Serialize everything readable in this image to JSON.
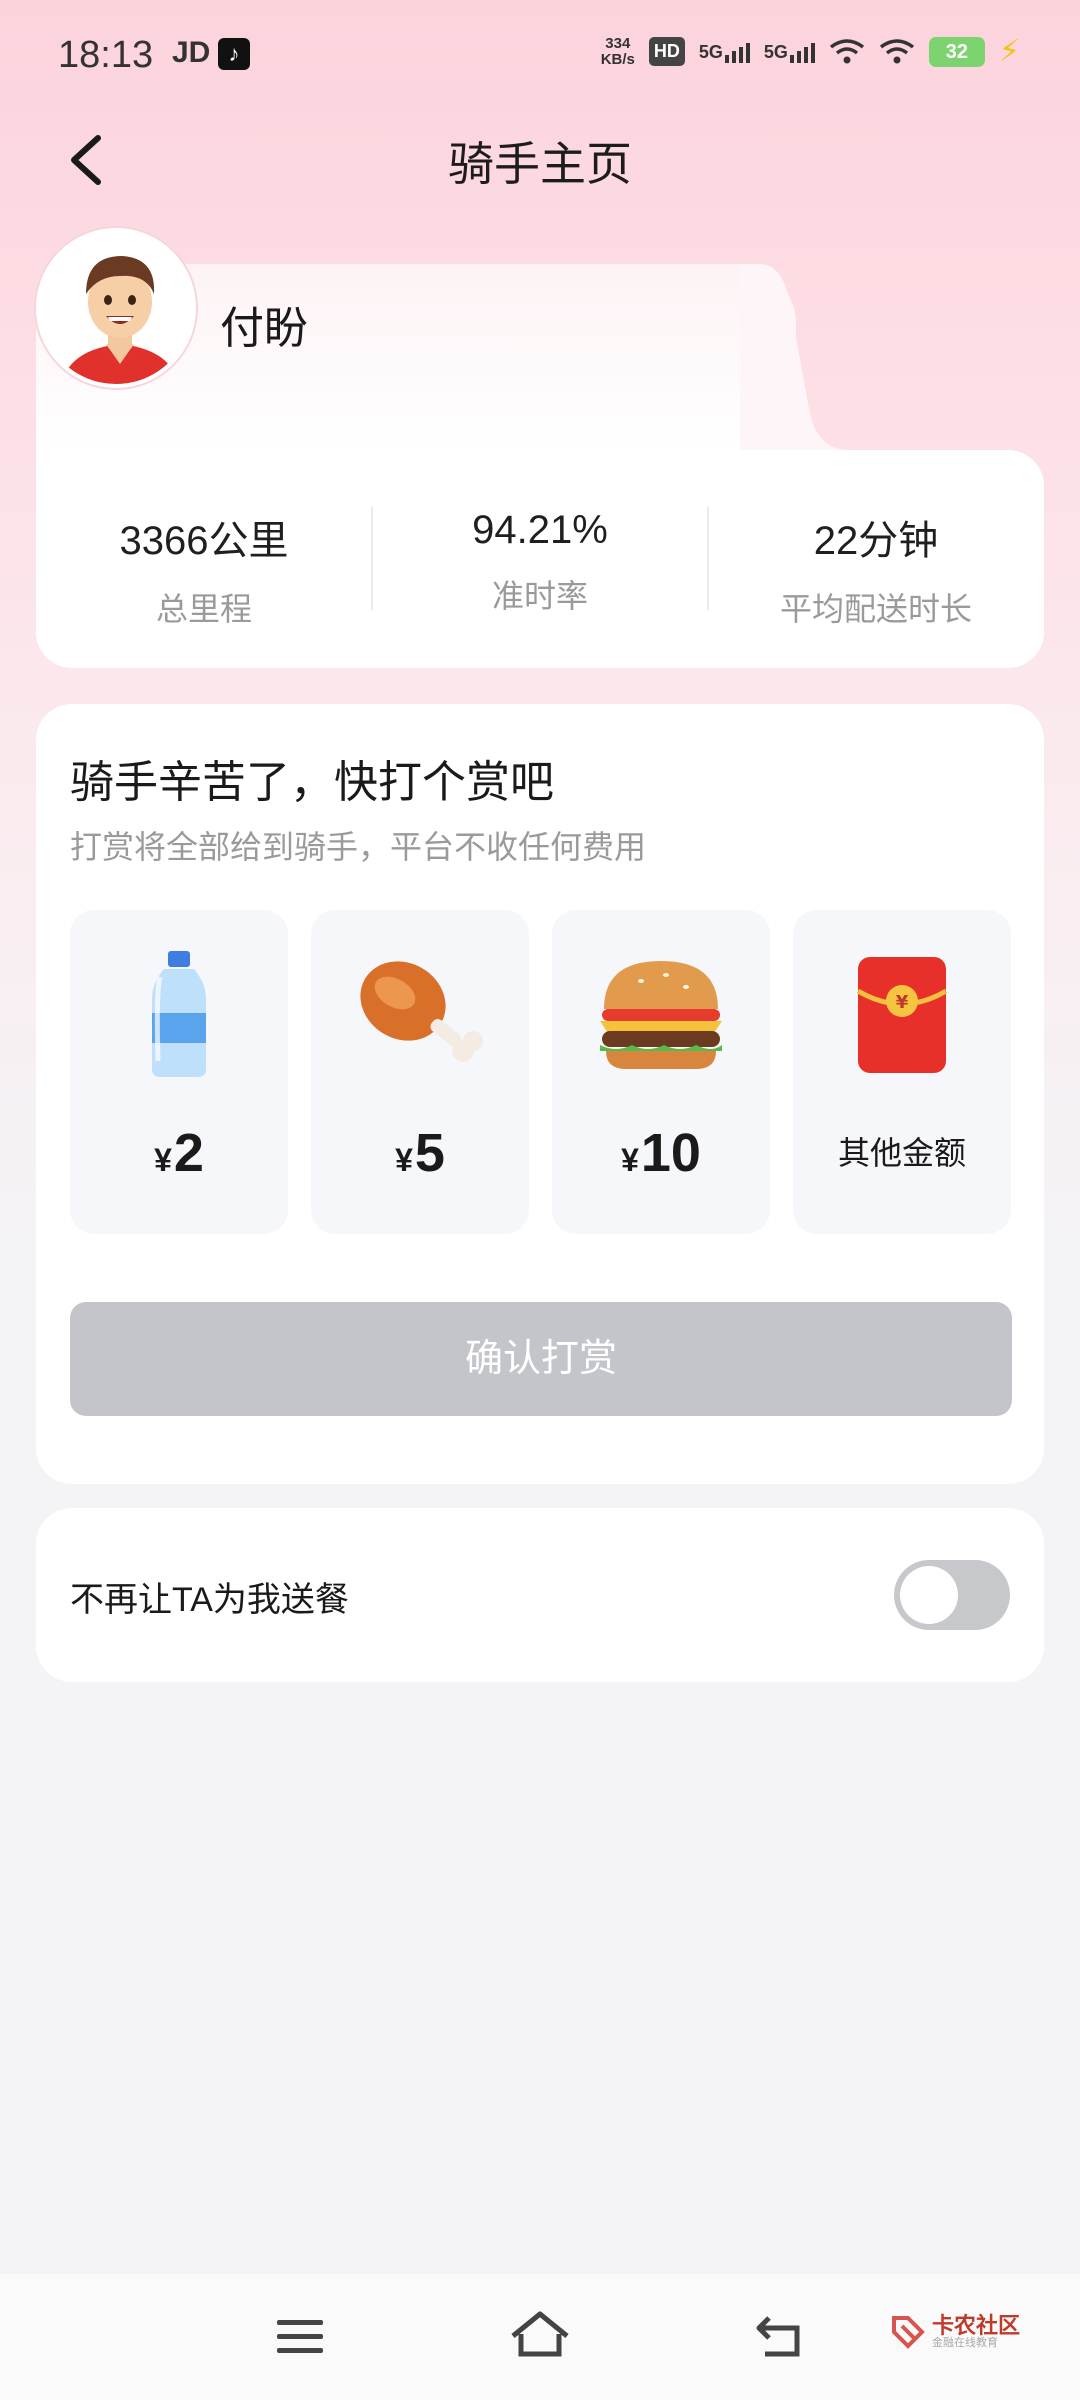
{
  "status_bar": {
    "time": "18:13",
    "app_label": "JD",
    "net_speed_value": "334",
    "net_speed_unit": "KB/s",
    "hd_label": "HD",
    "sim1": "5G",
    "sim2": "5G",
    "battery": "32"
  },
  "header": {
    "title": "骑手主页"
  },
  "rider": {
    "name": "付盼"
  },
  "stats": [
    {
      "value": "3366公里",
      "label": "总里程"
    },
    {
      "value": "94.21%",
      "label": "准时率"
    },
    {
      "value": "22分钟",
      "label": "平均配送时长"
    }
  ],
  "reward": {
    "title": "骑手辛苦了，快打个赏吧",
    "subtitle": "打赏将全部给到骑手，平台不收任何费用",
    "currency_symbol": "¥",
    "options": [
      {
        "icon": "water-bottle-icon",
        "amount": "2"
      },
      {
        "icon": "chicken-leg-icon",
        "amount": "5"
      },
      {
        "icon": "burger-icon",
        "amount": "10"
      },
      {
        "icon": "red-envelope-icon",
        "label": "其他金额"
      }
    ],
    "confirm_label": "确认打赏",
    "confirm_enabled": false
  },
  "block_rider": {
    "label": "不再让TA为我送餐",
    "toggle_on": false
  },
  "watermark": {
    "title": "卡农社区",
    "subtitle": "金融在线教育"
  },
  "colors": {
    "accent_pink": "#fcd3dc",
    "disabled_button": "#c3c5cb",
    "toggle_off": "#c7c8cc"
  }
}
